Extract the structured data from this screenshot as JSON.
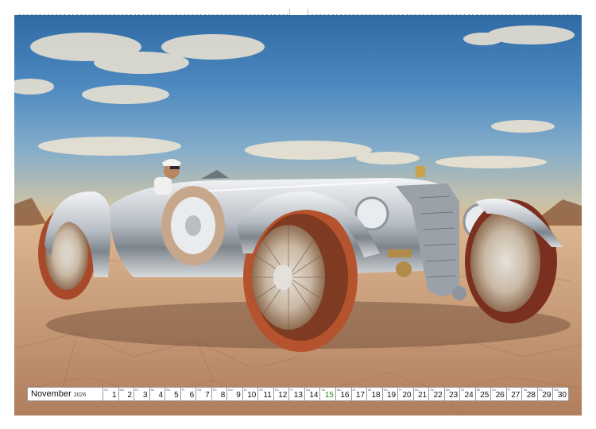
{
  "calendar": {
    "month": "November",
    "year": "2026",
    "days": [
      {
        "weekday": "So",
        "day": "1"
      },
      {
        "weekday": "Mo",
        "day": "2"
      },
      {
        "weekday": "Di",
        "day": "3"
      },
      {
        "weekday": "Mi",
        "day": "4"
      },
      {
        "weekday": "Do",
        "day": "5"
      },
      {
        "weekday": "Fr",
        "day": "6"
      },
      {
        "weekday": "Sa",
        "day": "7"
      },
      {
        "weekday": "So",
        "day": "8"
      },
      {
        "weekday": "Mo",
        "day": "9"
      },
      {
        "weekday": "Di",
        "day": "10"
      },
      {
        "weekday": "Mi",
        "day": "11"
      },
      {
        "weekday": "Do",
        "day": "12"
      },
      {
        "weekday": "Fr",
        "day": "13"
      },
      {
        "weekday": "Sa",
        "day": "14"
      },
      {
        "weekday": "So",
        "day": "15",
        "holiday": true
      },
      {
        "weekday": "Mo",
        "day": "16"
      },
      {
        "weekday": "Di",
        "day": "17"
      },
      {
        "weekday": "Mi",
        "day": "18"
      },
      {
        "weekday": "Do",
        "day": "19"
      },
      {
        "weekday": "Fr",
        "day": "20"
      },
      {
        "weekday": "Sa",
        "day": "21"
      },
      {
        "weekday": "So",
        "day": "22"
      },
      {
        "weekday": "Mo",
        "day": "23"
      },
      {
        "weekday": "Di",
        "day": "24"
      },
      {
        "weekday": "Mi",
        "day": "25"
      },
      {
        "weekday": "Do",
        "day": "26"
      },
      {
        "weekday": "Fr",
        "day": "27"
      },
      {
        "weekday": "Sa",
        "day": "28"
      },
      {
        "weekday": "So",
        "day": "29"
      },
      {
        "weekday": "Mo",
        "day": "30"
      }
    ]
  },
  "colors": {
    "sky_top": "#2f6aa5",
    "horizon": "#e3b680",
    "ground": "#c99c7a",
    "chrome": "#c8ccd0",
    "tire": "#b5542e",
    "holiday": "#2a8a2a"
  },
  "icons": {
    "binding": "spiral-binding-icon",
    "hanger": "hanger-hole-icon"
  }
}
